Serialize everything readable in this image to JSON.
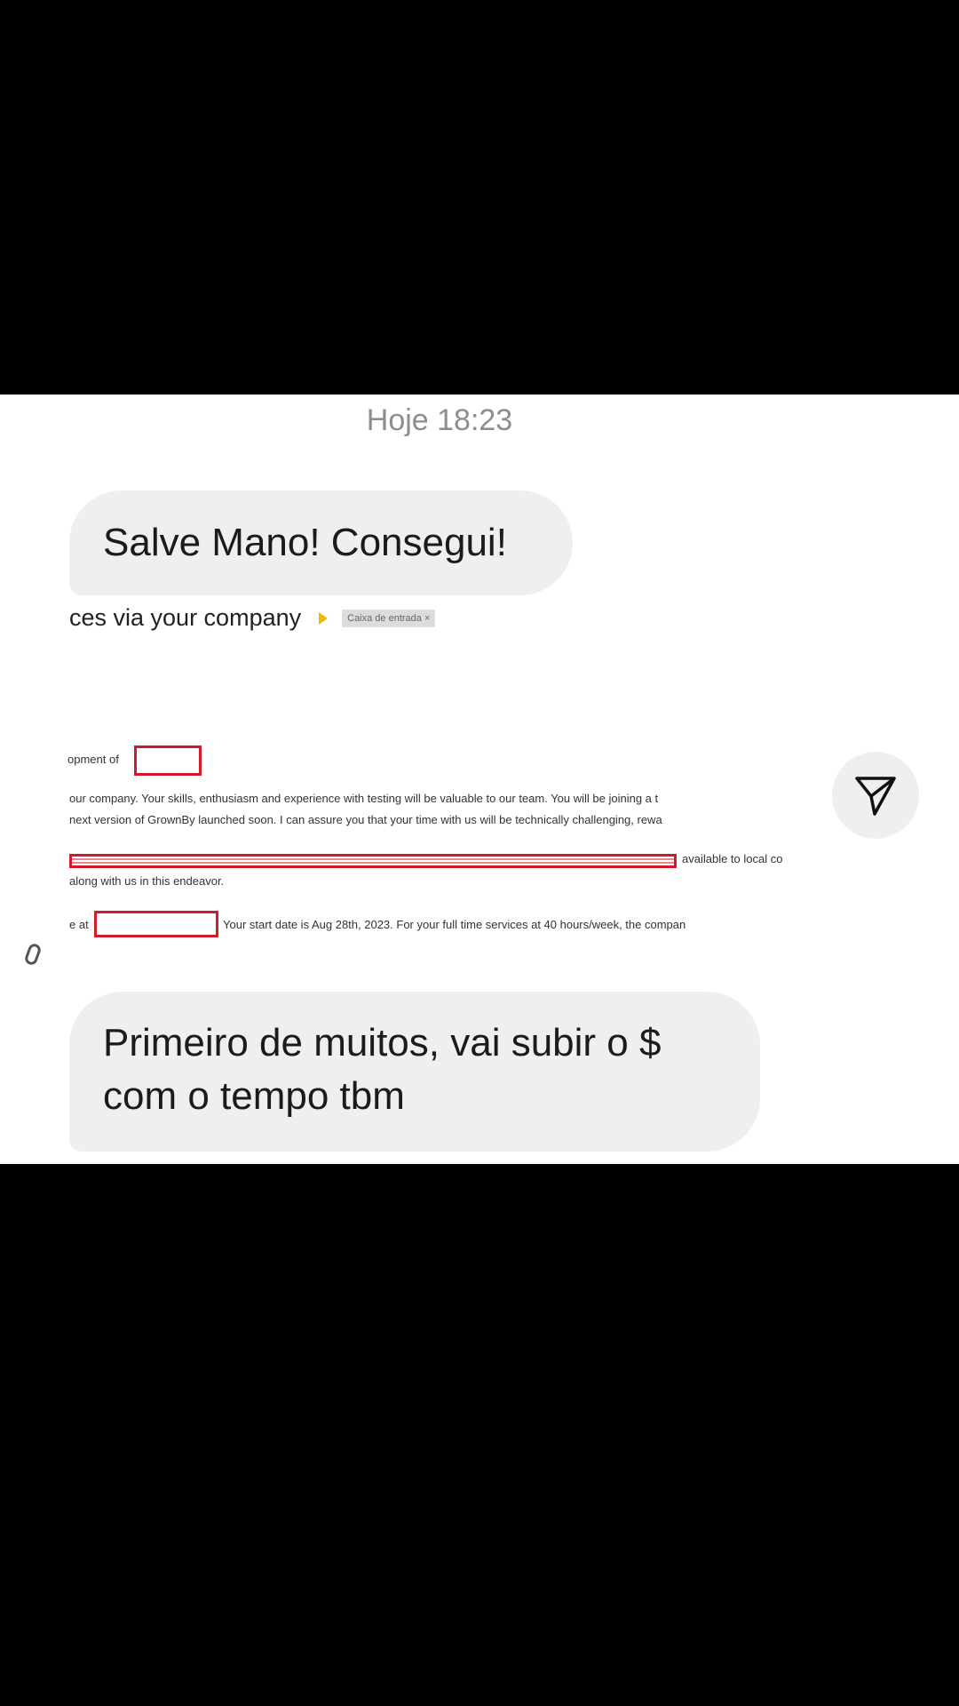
{
  "chat": {
    "timestamp": "Hoje 18:23",
    "messages": [
      {
        "text": "Salve Mano! Consegui!"
      },
      {
        "text": "Primeiro de muitos, vai subir o $ com o tempo tbm"
      }
    ]
  },
  "shared_image": {
    "subject": "ces via your company",
    "inbox_label": "Caixa de entrada ×",
    "lines": {
      "l1": "opment of",
      "l2": "our company. Your skills, enthusiasm and experience with testing will be valuable to our team. You will be joining a t",
      "l3": "next version of GrownBy launched soon. I can assure you that your time with us will be technically challenging, rewa",
      "l4": "available to local co",
      "l5": "along with us in this endeavor.",
      "l6a": "e at",
      "l6b": "Your start date is Aug 28th, 2023. For your full time services at 40 hours/week, the compan"
    }
  },
  "icons": {
    "share": "paper-plane-icon"
  },
  "colors": {
    "bubble_bg": "#efefef",
    "redaction": "#d11a2a",
    "timestamp": "#8e8e8e"
  }
}
